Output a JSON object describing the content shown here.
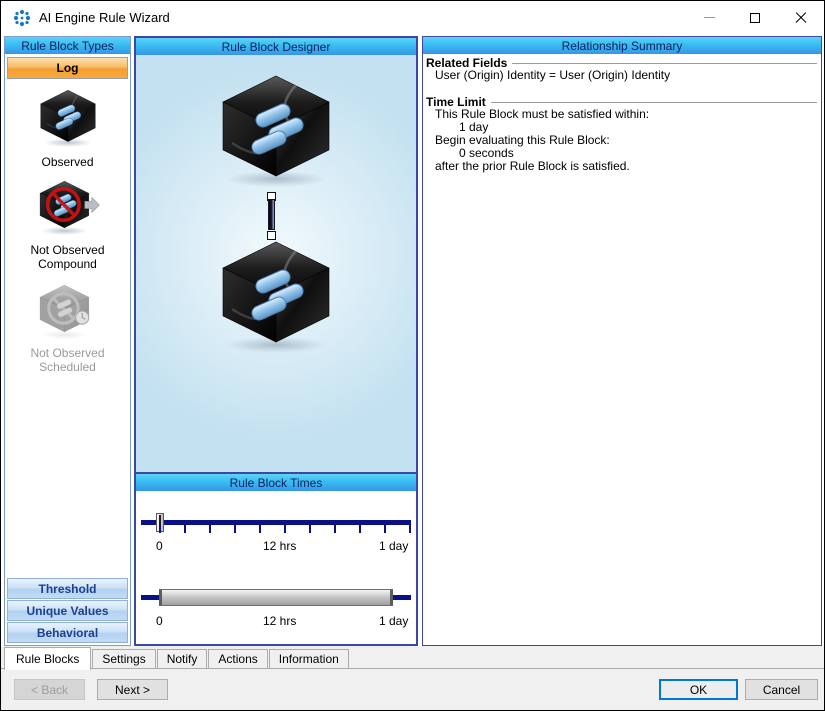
{
  "window": {
    "title": "AI Engine Rule Wizard",
    "controls": [
      "minimize-icon",
      "maximize-icon",
      "close-icon"
    ]
  },
  "left_panel": {
    "header": "Rule Block Types",
    "log_button": "Log",
    "types": [
      {
        "label": "Observed",
        "icon": "observed-cube-icon",
        "enabled": true
      },
      {
        "label": "Not Observed Compound",
        "icon": "not-observed-compound-cube-icon",
        "enabled": true
      },
      {
        "label": "Not Observed Scheduled",
        "icon": "not-observed-scheduled-cube-icon",
        "enabled": false
      }
    ],
    "category_buttons": [
      "Threshold",
      "Unique Values",
      "Behavioral"
    ]
  },
  "designer": {
    "header": "Rule Block Designer",
    "blocks": [
      "rule-block-cube",
      "rule-block-cube"
    ],
    "connector": "block-link-connector"
  },
  "times": {
    "header": "Rule Block Times",
    "sliders": [
      {
        "labels": [
          "0",
          "12 hrs",
          "1 day"
        ],
        "thumb_position": "0"
      },
      {
        "labels": [
          "0",
          "12 hrs",
          "1 day"
        ],
        "range": "0 to 1 day"
      }
    ]
  },
  "summary": {
    "header": "Relationship Summary",
    "related_fields": {
      "heading": "Related Fields",
      "value": "User (Origin) Identity = User (Origin) Identity"
    },
    "time_limit": {
      "heading": "Time Limit",
      "lines": [
        "This Rule Block must be satisfied within:",
        "1 day",
        "Begin evaluating this Rule Block:",
        "0 seconds",
        "after the prior Rule Block is satisfied."
      ]
    }
  },
  "tabs": [
    {
      "label": "Rule Blocks",
      "active": true
    },
    {
      "label": "Settings",
      "active": false
    },
    {
      "label": "Notify",
      "active": false
    },
    {
      "label": "Actions",
      "active": false
    },
    {
      "label": "Information",
      "active": false
    }
  ],
  "footer": {
    "back": "< Back",
    "next": "Next >",
    "ok": "OK",
    "cancel": "Cancel"
  },
  "colors": {
    "header_gradient_top": "#5fd2f7",
    "header_gradient_bottom": "#3795e6",
    "header_text": "#0b2161",
    "log_button_orange": "#f5a030",
    "category_button_text": "#1f3f8f",
    "slider_track_navy": "#0a1086",
    "panel_border_navy": "#3b47a0",
    "left_panel_border": "#7e9bd1",
    "pill_blue": "#8cc0e8",
    "prohibition_red": "#cc1111",
    "ok_focus_border": "#0078d7",
    "logo_blue": "#1779c4"
  }
}
